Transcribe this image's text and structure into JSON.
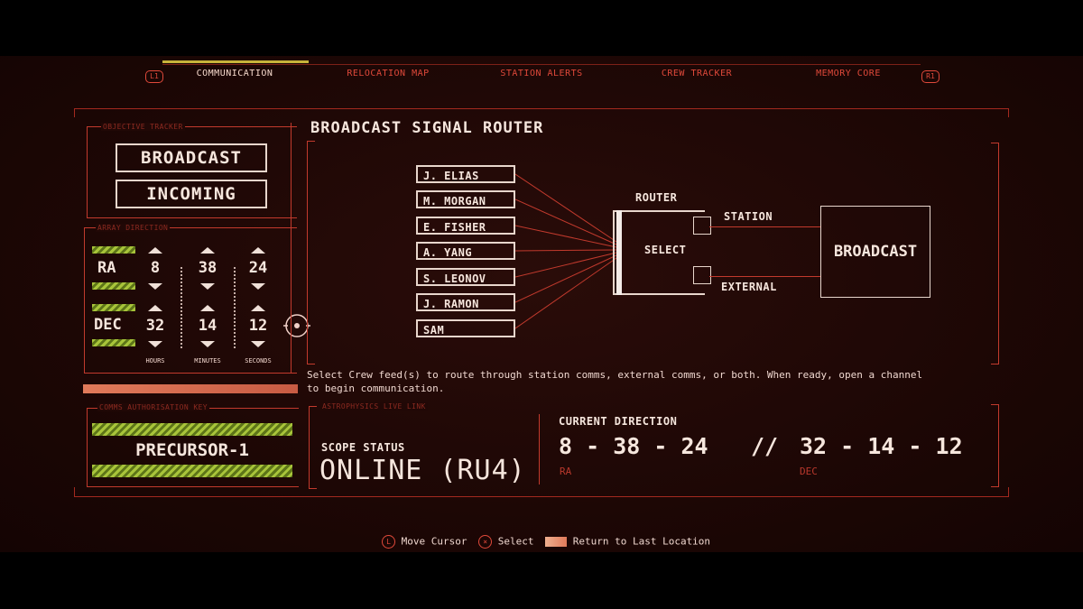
{
  "nav": {
    "left_bumper": "L1",
    "right_bumper": "R1",
    "tabs": [
      "COMMUNICATION",
      "RELOCATION MAP",
      "STATION ALERTS",
      "CREW TRACKER",
      "MEMORY CORE"
    ],
    "active_tab": "COMMUNICATION"
  },
  "objective": {
    "label": "OBJECTIVE TRACKER",
    "primary": "BROADCAST",
    "secondary": "INCOMING"
  },
  "array": {
    "label": "ARRAY DIRECTION",
    "ra": {
      "label": "RA",
      "hours": "8",
      "minutes": "38",
      "seconds": "24"
    },
    "dec": {
      "label": "DEC",
      "hours": "32",
      "minutes": "14",
      "seconds": "12"
    },
    "units": [
      "HOURS",
      "MINUTES",
      "SECONDS"
    ]
  },
  "auth": {
    "label": "COMMS AUTHORISATION KEY",
    "key": "PRECURSOR-1"
  },
  "router": {
    "title": "BROADCAST SIGNAL ROUTER",
    "crew": [
      "J. ELIAS",
      "M. MORGAN",
      "E. FISHER",
      "A. YANG",
      "S. LEONOV",
      "J. RAMON",
      "SAM"
    ],
    "router_label": "ROUTER",
    "select_label": "SELECT",
    "station_label": "STATION",
    "external_label": "EXTERNAL",
    "broadcast_label": "BROADCAST",
    "help_line1": "Select Crew feed(s) to route through station comms, external comms, or both. When ready, open a channel",
    "help_line2": "to begin communication."
  },
  "astro": {
    "label": "ASTROPHYSICS LIVE LINK",
    "scope_label": "SCOPE STATUS",
    "scope_value": "ONLINE (RU4)",
    "direction_label": "CURRENT DIRECTION",
    "ra_value": "8 - 38 - 24",
    "separator": "//",
    "dec_value": "32 - 14 - 12",
    "ra_caption": "RA",
    "dec_caption": "DEC"
  },
  "footer": {
    "move_icon": "L",
    "move_label": "Move Cursor",
    "select_icon": "×",
    "select_label": "Select",
    "return_label": "Return to Last Location"
  },
  "colors": {
    "accent": "#e0493a",
    "text": "#f6e6dd",
    "bg": "#1d0705",
    "stripe": "#a8c43a"
  }
}
